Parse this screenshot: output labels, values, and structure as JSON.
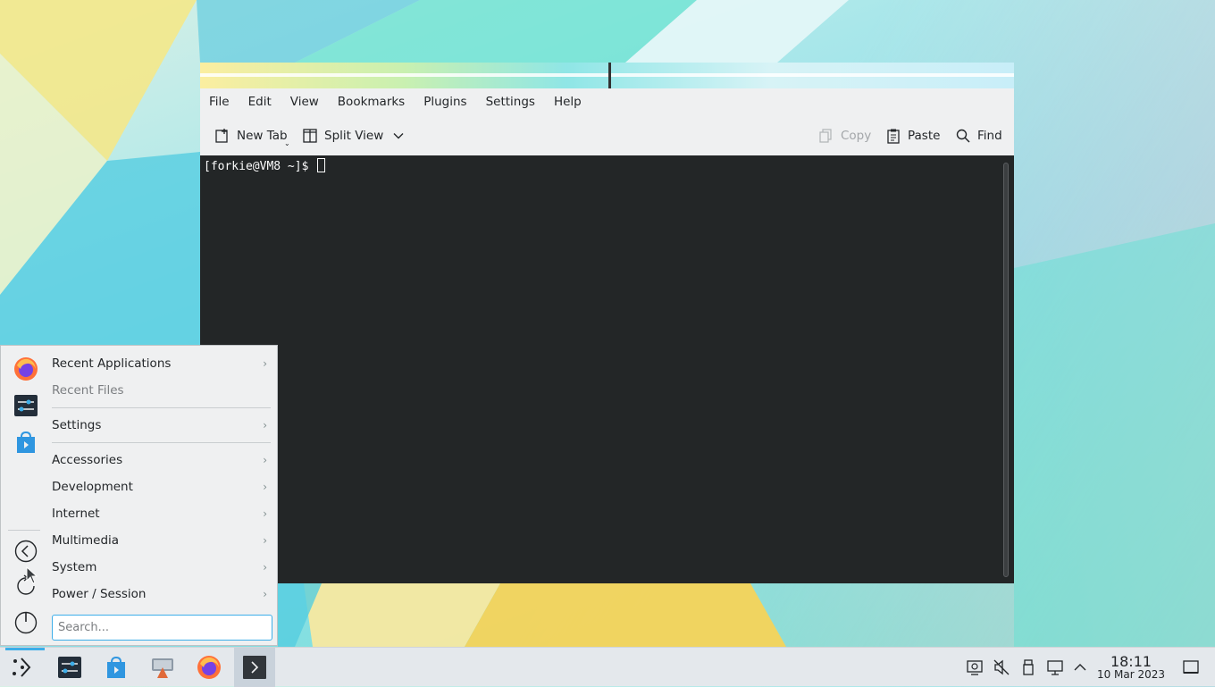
{
  "konsole": {
    "menu": [
      "File",
      "Edit",
      "View",
      "Bookmarks",
      "Plugins",
      "Settings",
      "Help"
    ],
    "toolbar": {
      "new_tab": "New Tab",
      "split_view": "Split View",
      "copy": "Copy",
      "paste": "Paste",
      "find": "Find"
    },
    "prompt": "[forkie@VM8 ~]$ "
  },
  "appmenu": {
    "favorites": [
      "firefox-icon",
      "system-settings-icon",
      "discover-icon"
    ],
    "categories": [
      {
        "label": "Recent Applications",
        "has_submenu": true
      },
      {
        "label": "Recent Files",
        "has_submenu": false
      },
      {
        "label": "Settings",
        "has_submenu": true
      },
      {
        "label": "Accessories",
        "has_submenu": true
      },
      {
        "label": "Development",
        "has_submenu": true
      },
      {
        "label": "Internet",
        "has_submenu": true
      },
      {
        "label": "Multimedia",
        "has_submenu": true
      },
      {
        "label": "System",
        "has_submenu": true
      },
      {
        "label": "Power / Session",
        "has_submenu": true
      }
    ],
    "search_placeholder": "Search..."
  },
  "taskbar": {
    "apps": [
      "application-launcher",
      "system-settings",
      "discover",
      "dolphin-file-manager",
      "firefox",
      "konsole"
    ],
    "clock_time": "18:11",
    "clock_date": "10 Mar 2023"
  },
  "colors": {
    "accent": "#3daee9",
    "terminal_bg": "#232627",
    "window_bg": "#eff0f1"
  }
}
